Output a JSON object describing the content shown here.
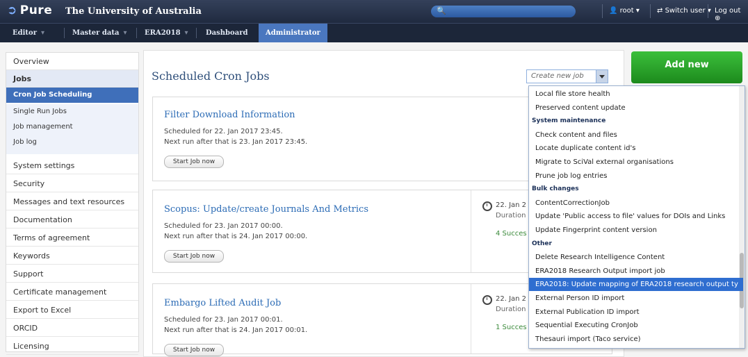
{
  "header": {
    "logo_text": "Pure",
    "org_name": "The University of Australia",
    "user_label": "root ▾",
    "switch_user_label": "Switch user ▾",
    "logout_label": "Log out"
  },
  "nav": {
    "items": [
      {
        "label": "Editor"
      },
      {
        "label": "Master data"
      },
      {
        "label": "ERA2018"
      },
      {
        "label": "Dashboard"
      },
      {
        "label": "Administrator"
      }
    ]
  },
  "sidebar": {
    "overview": "Overview",
    "jobs": "Jobs",
    "sub": [
      "Cron Job Scheduling",
      "Single Run Jobs",
      "Job management",
      "Job log"
    ],
    "items": [
      "System settings",
      "Security",
      "Messages and text resources",
      "Documentation",
      "Terms of agreement",
      "Keywords",
      "Support",
      "Certificate management",
      "Export to Excel",
      "ORCID",
      "Licensing"
    ]
  },
  "main": {
    "title": "Scheduled Cron Jobs",
    "create_placeholder": "Create new job",
    "add_new_label": "Add new",
    "cards": [
      {
        "title": "Filter Download Information",
        "scheduled": "Scheduled for 22. Jan 2017 23:45.",
        "next": "Next run after that is 23. Jan 2017 23:45.",
        "button": "Start Job now"
      },
      {
        "title": "Scopus: Update/create Journals And Metrics",
        "scheduled": "Scheduled for 23. Jan 2017 00:00.",
        "next": "Next run after that is 24. Jan 2017 00:00.",
        "button": "Start Job now",
        "hist_date": "22. Jan 2",
        "hist_duration": "Duration",
        "hist_success": "4 Succes"
      },
      {
        "title": "Embargo Lifted Audit Job",
        "scheduled": "Scheduled for 23. Jan 2017 00:01.",
        "next": "Next run after that is 24. Jan 2017 00:01.",
        "button": "Start Job now",
        "hist_date": "22. Jan 2",
        "hist_duration": "Duration",
        "hist_success": "1 Succes"
      }
    ]
  },
  "dropdown": {
    "rows": [
      {
        "text": "Local file store health",
        "type": "item"
      },
      {
        "text": "Preserved content update",
        "type": "item"
      },
      {
        "text": "System maintenance",
        "type": "header"
      },
      {
        "text": "Check content and files",
        "type": "item"
      },
      {
        "text": "Locate duplicate content id's",
        "type": "item"
      },
      {
        "text": "Migrate to SciVal external organisations",
        "type": "item"
      },
      {
        "text": "Prune job log entries",
        "type": "item"
      },
      {
        "text": "Bulk changes",
        "type": "header"
      },
      {
        "text": "ContentCorrectionJob",
        "type": "item"
      },
      {
        "text": "Update 'Public access to file' values for DOIs and Links",
        "type": "item"
      },
      {
        "text": "Update Fingerprint content version",
        "type": "item"
      },
      {
        "text": "Other",
        "type": "header"
      },
      {
        "text": "Delete Research Intelligence Content",
        "type": "item"
      },
      {
        "text": "ERA2018 Research Output import job",
        "type": "item"
      },
      {
        "text": "ERA2018: Update mapping of ERA2018 research output ty",
        "type": "selected"
      },
      {
        "text": "External Person ID import",
        "type": "item"
      },
      {
        "text": "External Publication ID import",
        "type": "item"
      },
      {
        "text": "Sequential Executing CronJob",
        "type": "item"
      },
      {
        "text": "Thesauri import (Taco service)",
        "type": "item"
      }
    ]
  }
}
